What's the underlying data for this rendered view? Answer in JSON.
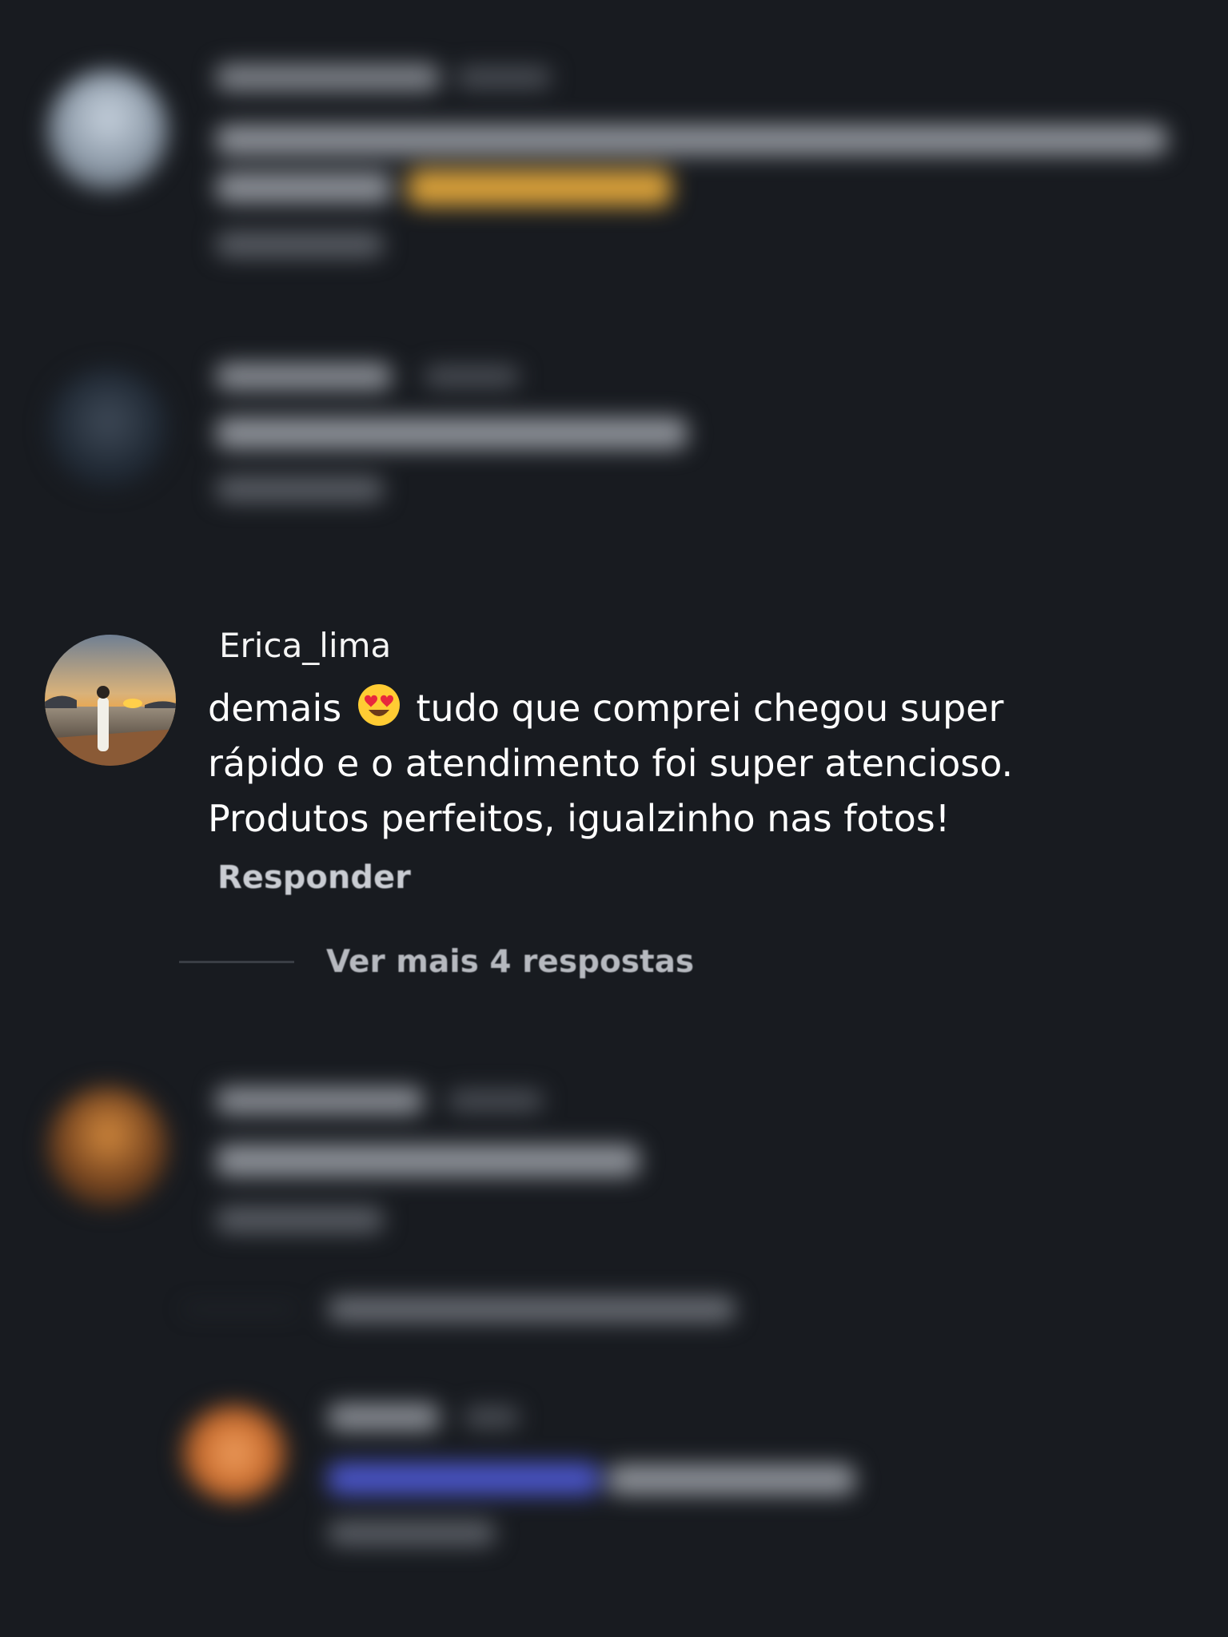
{
  "comment": {
    "username": "Erica_lima",
    "text_before_emoji": "demais ",
    "emoji": "heart-eyes-emoji",
    "text_after_emoji": " tudo que comprei chegou super rápido e o atendimento foi super atencioso. Produtos perfeitos, igualzinho nas fotos!",
    "reply_label": "Responder"
  },
  "more_replies_label": "Ver mais 4 respostas",
  "colors": {
    "background": "#181b20",
    "text": "#ffffff",
    "muted": "#b6b9bf"
  }
}
